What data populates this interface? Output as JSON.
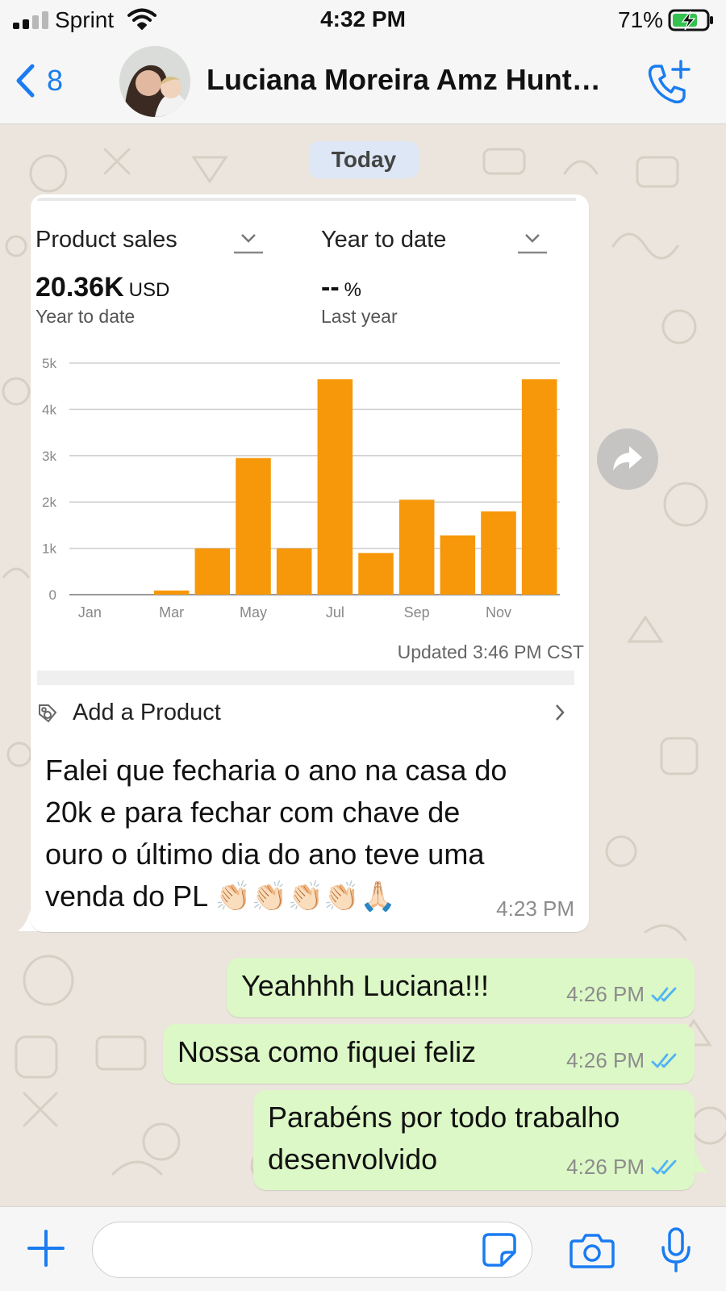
{
  "status_bar": {
    "carrier": "Sprint",
    "time": "4:32 PM",
    "battery": "71%"
  },
  "header": {
    "back_count": "8",
    "contact_name": "Luciana Moreira Amz Hunt…"
  },
  "chat": {
    "date_label": "Today",
    "incoming": {
      "screenshot": {
        "metric_left_label": "Product sales",
        "metric_left_value": "20.36K",
        "metric_left_unit": "USD",
        "metric_left_sub": "Year to date",
        "metric_right_label": "Year to date",
        "metric_right_value": "--",
        "metric_right_unit": "%",
        "metric_right_sub": "Last year",
        "updated": "Updated 3:46 PM CST",
        "add_product": "Add a Product",
        "accent_color": "#f7980a"
      },
      "text_lines": [
        "Falei que fecharia o ano na casa do",
        "20k e para fechar com chave de",
        "ouro o último dia do ano teve uma",
        "venda do PL 👏🏻👏🏻👏🏻👏🏻🙏🏻"
      ],
      "time": "4:23 PM"
    },
    "outgoing": [
      {
        "lines": [
          "Yeahhhh Luciana!!!"
        ],
        "time": "4:26 PM"
      },
      {
        "lines": [
          "Nossa como fiquei feliz"
        ],
        "time": "4:26 PM"
      },
      {
        "lines": [
          "Parabéns por todo trabalho",
          "desenvolvido"
        ],
        "time": "4:26 PM"
      }
    ]
  },
  "input": {
    "placeholder": ""
  },
  "chart_data": {
    "type": "bar",
    "title": "",
    "xlabel": "",
    "ylabel": "",
    "categories": [
      "Jan",
      "Feb",
      "Mar",
      "Apr",
      "May",
      "Jun",
      "Jul",
      "Aug",
      "Sep",
      "Oct",
      "Nov",
      "Dec"
    ],
    "x_tick_labels": [
      "Jan",
      "",
      "Mar",
      "",
      "May",
      "",
      "Jul",
      "",
      "Sep",
      "",
      "Nov",
      ""
    ],
    "values": [
      0,
      0,
      90,
      1000,
      2950,
      1000,
      4650,
      900,
      2050,
      1280,
      1800,
      4650
    ],
    "y_ticks": [
      0,
      1000,
      2000,
      3000,
      4000,
      5000
    ],
    "y_tick_labels": [
      "0",
      "1k",
      "2k",
      "3k",
      "4k",
      "5k"
    ],
    "ylim": [
      0,
      5000
    ],
    "grid": true,
    "color": "#f7980a"
  }
}
